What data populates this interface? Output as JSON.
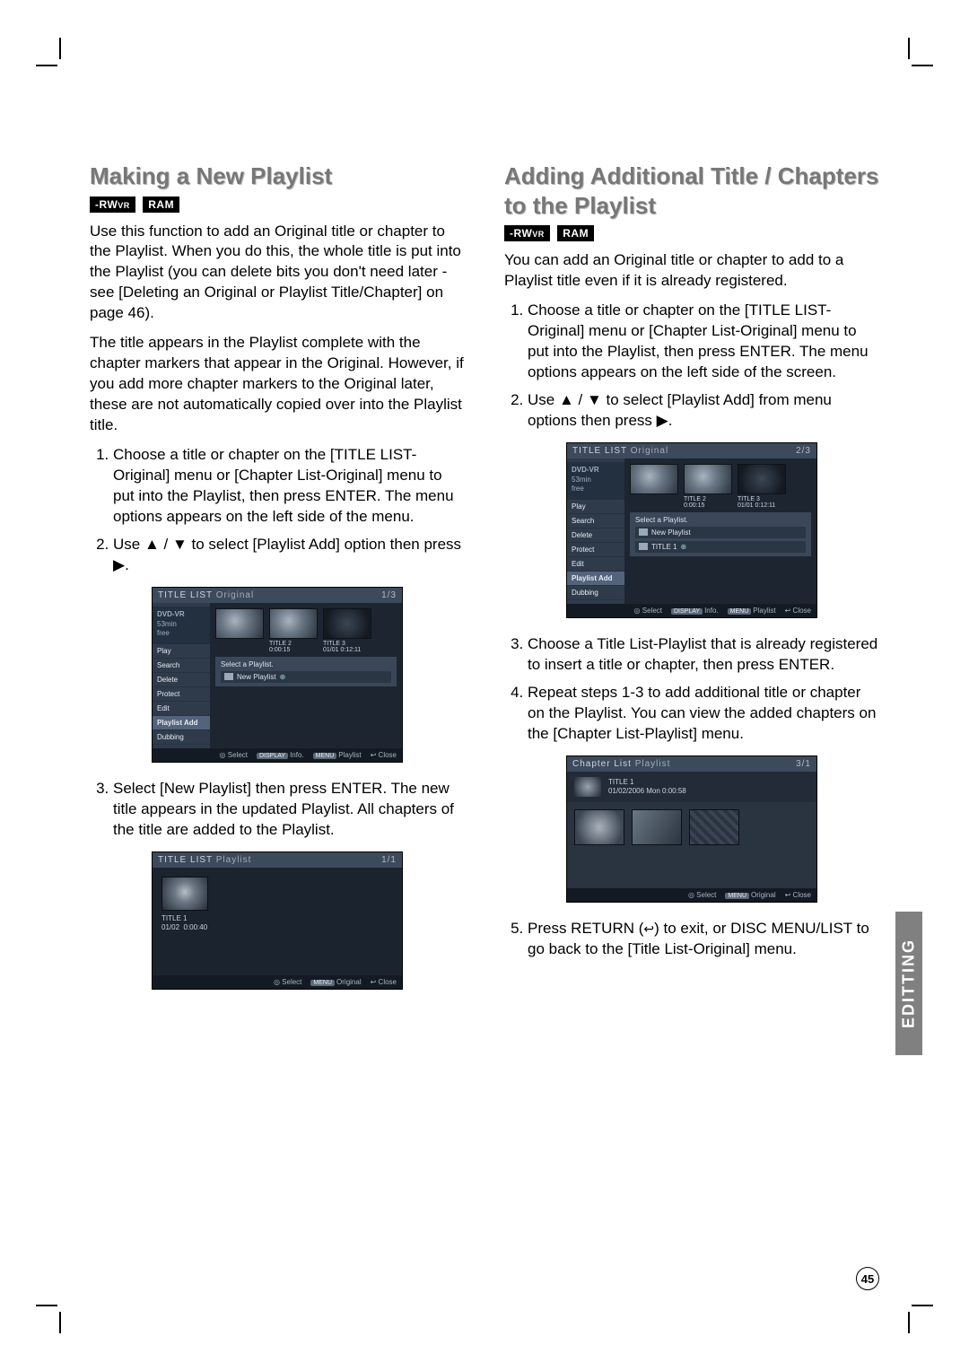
{
  "page_number": "45",
  "side_tab": "EDITTING",
  "left": {
    "heading": "Making a New Playlist",
    "badges": {
      "rwvr_prefix": "-RW",
      "rwvr_suffix": "VR",
      "ram": "RAM"
    },
    "para1": "Use this function to add an Original title or chapter to the Playlist. When you do this, the whole title is put into the Playlist (you can delete bits you don't need later - see [Deleting an Original or Playlist Title/Chapter] on page 46).",
    "para2": "The title appears in the Playlist complete with the chapter markers that appear in the Original. However, if you add more chapter markers to the Original later, these are not automatically copied over into the Playlist title.",
    "step1": "Choose a title or chapter on the [TITLE LIST-Original] menu or [Chapter List-Original] menu to put into the Playlist, then press ENTER. The menu options appears on the left side of the menu.",
    "step2_a": "Use ",
    "step2_arrows": "▲ / ▼",
    "step2_b": " to select [Playlist Add] option then press ",
    "step2_arrow_right": "▶",
    "step2_c": ".",
    "step3": "Select [New Playlist] then press ENTER. The new title appears in the updated Playlist. All chapters of the title are added to the Playlist.",
    "fig1": {
      "header_left": "TITLE LIST",
      "header_sub": "Original",
      "header_right": "1/3",
      "sb_top_l1": "DVD-VR",
      "sb_top_l2": "53min",
      "sb_top_l3": "free",
      "sb_items": [
        "Play",
        "Search",
        "Delete",
        "Protect",
        "Edit",
        "Playlist Add",
        "Dubbing"
      ],
      "sb_highlight": "Playlist Add",
      "sel_label": "Select a Playlist.",
      "np_label": "New Playlist",
      "thumb2_line1": "TITLE 2",
      "thumb2_line2": "0:00:15",
      "thumb3_line1": "TITLE 3",
      "thumb3_line2": "01/01",
      "thumb3_line3": "0:12:11",
      "footer": [
        "Select",
        "Info.",
        "Playlist",
        "Close"
      ],
      "footer_keys": [
        "",
        "DISPLAY",
        "MENU",
        ""
      ],
      "footer_icons": [
        "◎",
        "",
        "",
        "↩"
      ]
    },
    "fig2": {
      "header_left": "TITLE LIST",
      "header_sub": "Playlist",
      "header_right": "1/1",
      "info_l1": "TITLE 1",
      "info_l2": "01/02",
      "info_l3": "0:00:40",
      "footer": [
        "Select",
        "Original",
        "Close"
      ],
      "footer_keys": [
        "",
        "MENU",
        ""
      ],
      "footer_icons": [
        "◎",
        "",
        "↩"
      ]
    }
  },
  "right": {
    "heading": "Adding Additional Title / Chapters to the Playlist",
    "badges": {
      "rwvr_prefix": "-RW",
      "rwvr_suffix": "VR",
      "ram": "RAM"
    },
    "para1": "You can add an Original title or chapter to add to a Playlist title even if it is already registered.",
    "step1": "Choose a title or chapter on the [TITLE LIST-Original] menu or [Chapter List-Original] menu to put into the Playlist, then press ENTER. The menu options appears on the left side of the screen.",
    "step2_a": "Use ",
    "step2_arrows": "▲ / ▼",
    "step2_b": " to select [Playlist Add] from menu options then press ",
    "step2_arrow_right": "▶",
    "step2_c": ".",
    "step3": "Choose a Title List-Playlist that is already registered to insert a title or chapter, then press ENTER.",
    "step4": "Repeat steps 1-3 to add additional title or chapter on the Playlist. You can view the added chapters on the [Chapter List-Playlist] menu.",
    "step5_a": "Press RETURN (",
    "step5_icon": "↩",
    "step5_b": ") to exit, or DISC MENU/LIST to go back to the [Title List-Original] menu.",
    "fig1": {
      "header_left": "TITLE LIST",
      "header_sub": "Original",
      "header_right": "2/3",
      "sb_top_l1": "DVD-VR",
      "sb_top_l2": "53min",
      "sb_top_l3": "free",
      "sb_items": [
        "Play",
        "Search",
        "Delete",
        "Protect",
        "Edit",
        "Playlist Add",
        "Dubbing"
      ],
      "sb_highlight": "Playlist Add",
      "sel_label": "Select a Playlist.",
      "np_label": "New Playlist",
      "row2_label": "TITLE 1",
      "thumb2_line1": "TITLE 2",
      "thumb2_line2": "0:00:15",
      "thumb3_line1": "TITLE 3",
      "thumb3_line2": "01/01",
      "thumb3_line3": "0:12:11",
      "footer": [
        "Select",
        "Info.",
        "Playlist",
        "Close"
      ],
      "footer_keys": [
        "",
        "DISPLAY",
        "MENU",
        ""
      ],
      "footer_icons": [
        "◎",
        "",
        "",
        "↩"
      ]
    },
    "fig2": {
      "header_left": "Chapter List",
      "header_sub": "Playlist",
      "header_right": "3/1",
      "info_l1": "TITLE 1",
      "info_l2": "01/02/2006 Mon 0:00:58",
      "footer": [
        "Select",
        "Original",
        "Close"
      ],
      "footer_keys": [
        "",
        "MENU",
        ""
      ],
      "footer_icons": [
        "◎",
        "",
        "↩"
      ]
    }
  }
}
